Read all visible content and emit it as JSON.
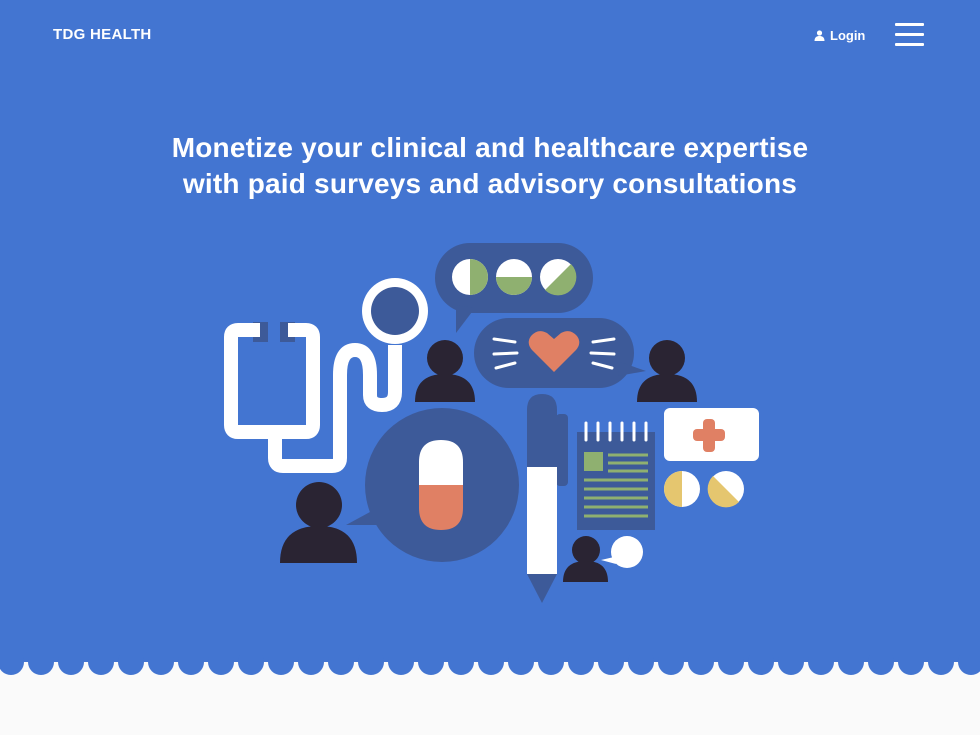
{
  "header": {
    "brand": "TDG HEALTH",
    "login_label": "Login",
    "icons": {
      "login": "user-icon",
      "menu": "hamburger-menu-icon"
    }
  },
  "hero": {
    "headline_line1": "Monetize your clinical and healthcare expertise",
    "headline_line2": "with paid surveys and advisory consultations",
    "illustration": "medical-consultation-illustration"
  },
  "colors": {
    "hero_background": "#4375d1",
    "page_background": "#fafafa",
    "dark_blue": "#3d5a99",
    "person": "#2a2433",
    "green": "#8fb070",
    "orange": "#e08064",
    "yellow": "#e5c66f",
    "white": "#ffffff"
  }
}
